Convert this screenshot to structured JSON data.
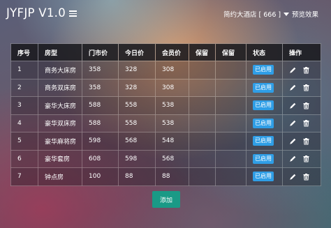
{
  "app": {
    "title": "JYFJP V1.0"
  },
  "header": {
    "hotel_select": "简约大酒店 [ 666 ]",
    "preview_link": "预览效果"
  },
  "table": {
    "columns": [
      "序号",
      "房型",
      "门市价",
      "今日价",
      "会员价",
      "保留",
      "保留",
      "状态",
      "操作"
    ],
    "rows": [
      {
        "no": "1",
        "type": "商务大床房",
        "rack": "358",
        "today": "328",
        "member": "308",
        "r1": "",
        "r2": "",
        "status": "已启用"
      },
      {
        "no": "2",
        "type": "商务双床房",
        "rack": "358",
        "today": "328",
        "member": "308",
        "r1": "",
        "r2": "",
        "status": "已启用"
      },
      {
        "no": "3",
        "type": "豪华大床房",
        "rack": "588",
        "today": "558",
        "member": "538",
        "r1": "",
        "r2": "",
        "status": "已启用"
      },
      {
        "no": "4",
        "type": "豪华双床房",
        "rack": "588",
        "today": "558",
        "member": "538",
        "r1": "",
        "r2": "",
        "status": "已启用"
      },
      {
        "no": "5",
        "type": "豪华麻将房",
        "rack": "598",
        "today": "568",
        "member": "548",
        "r1": "",
        "r2": "",
        "status": "已启用"
      },
      {
        "no": "6",
        "type": "豪华套房",
        "rack": "608",
        "today": "598",
        "member": "568",
        "r1": "",
        "r2": "",
        "status": "已启用"
      },
      {
        "no": "7",
        "type": "钟点房",
        "rack": "100",
        "today": "88",
        "member": "88",
        "r1": "",
        "r2": "",
        "status": "已启用"
      }
    ]
  },
  "actions": {
    "add_label": "添加"
  },
  "icons": {
    "menu": "menu-icon",
    "edit": "pencil-icon",
    "delete": "trash-icon",
    "dropdown": "caret-down-icon"
  },
  "colors": {
    "status_badge": "#2f9ee6",
    "add_button": "#1a9a86",
    "header_row": "#19191e"
  }
}
